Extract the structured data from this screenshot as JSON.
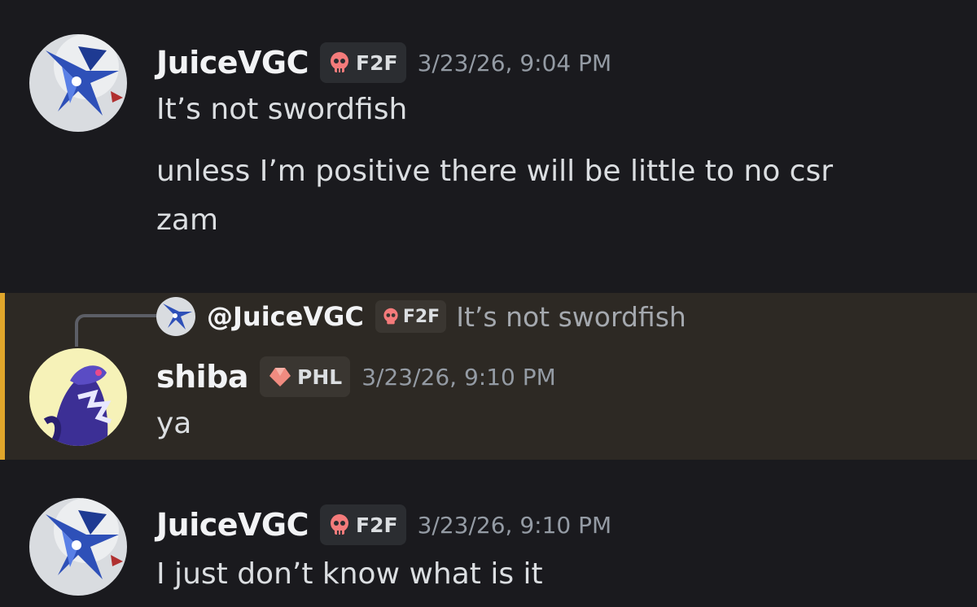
{
  "messages": [
    {
      "username": "JuiceVGC",
      "tag_label": "F2F",
      "tag_icon": "skull-icon",
      "timestamp": "3/23/26, 9:04 PM",
      "lines": [
        "It’s not swordfish",
        "unless I’m positive there will be little to no csr",
        "zam"
      ]
    },
    {
      "reply_to": {
        "mention": "@JuiceVGC",
        "tag_label": "F2F",
        "tag_icon": "skull-icon",
        "preview": "It’s not swordfish"
      },
      "username": "shiba",
      "tag_label": "PHL",
      "tag_icon": "gem-icon",
      "timestamp": "3/23/26, 9:10 PM",
      "lines": [
        "ya"
      ]
    },
    {
      "username": "JuiceVGC",
      "tag_label": "F2F",
      "tag_icon": "skull-icon",
      "timestamp": "3/23/26, 9:10 PM",
      "lines": [
        "I just don’t know what is it"
      ]
    }
  ],
  "colors": {
    "background": "#1a1a1e",
    "highlight_background": "#2d2924",
    "highlight_bar": "#e0a62b",
    "skull": "#f47b7b",
    "gem": "#f08b80"
  }
}
